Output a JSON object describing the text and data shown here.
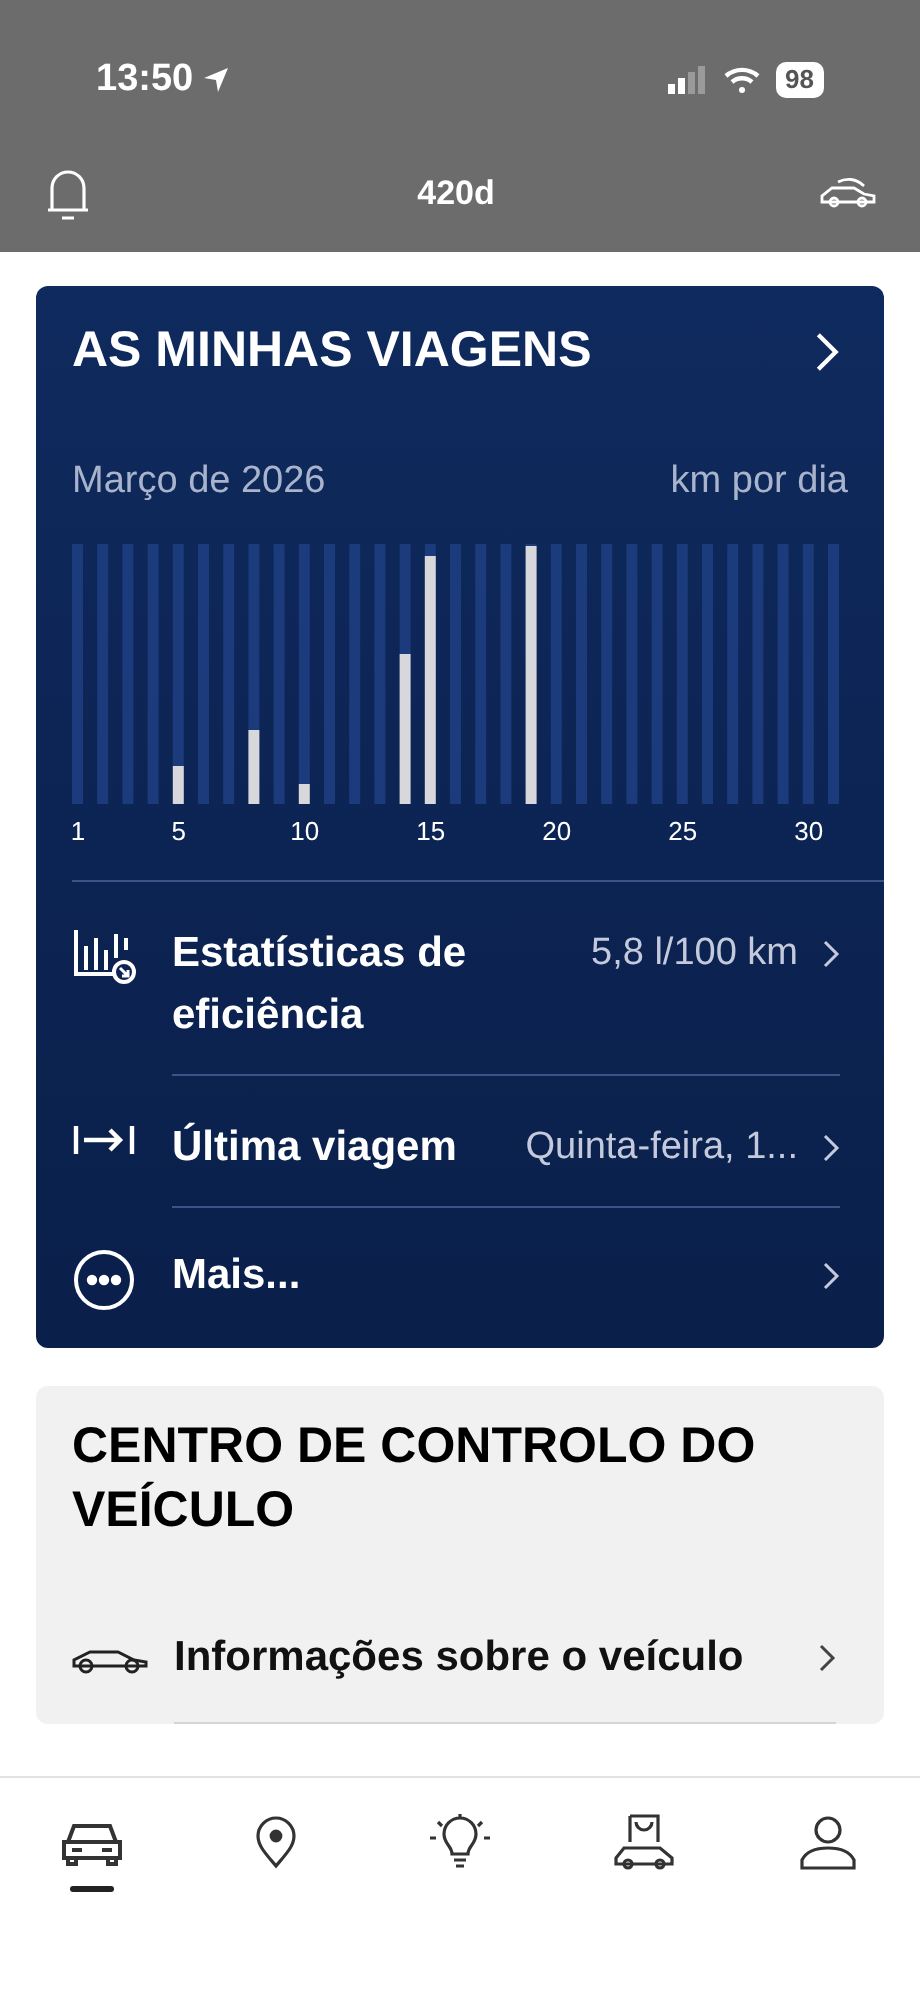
{
  "status_bar": {
    "time": "13:50",
    "battery": "98"
  },
  "header": {
    "title": "420d"
  },
  "trips_card": {
    "title": "AS MINHAS VIAGENS",
    "month": "Março de 2026",
    "unit": "km por dia",
    "day_labels": [
      "1",
      "5",
      "10",
      "15",
      "20",
      "25",
      "30"
    ],
    "rows": [
      {
        "kind": "stats",
        "label": "Estatísticas de eficiência",
        "value": "5,8 l/100 km"
      },
      {
        "kind": "trip",
        "label": "Última viagem",
        "value": "Quinta-feira, 1..."
      },
      {
        "kind": "more",
        "label": "Mais..."
      }
    ]
  },
  "control_card": {
    "title": "CENTRO DE CONTROLO DO VEÍCULO",
    "rows": [
      {
        "label": "Informações sobre o veículo"
      }
    ]
  },
  "bottom_nav": [
    {
      "kind": "car",
      "selected": true
    },
    {
      "kind": "map",
      "selected": false
    },
    {
      "kind": "ideas",
      "selected": false
    },
    {
      "kind": "shop",
      "selected": false
    },
    {
      "kind": "profile",
      "selected": false
    }
  ]
}
